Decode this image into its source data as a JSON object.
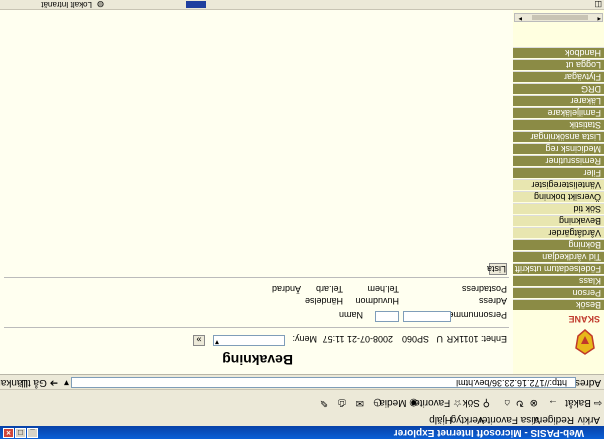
{
  "window": {
    "title": "Web-PASIS - Microsoft Internet Explorer"
  },
  "menu": {
    "items": [
      "Arkiv",
      "Redigera",
      "Visa",
      "Favoriter",
      "Verktyg",
      "Hjälp"
    ]
  },
  "toolbar": {
    "back": "Bakåt",
    "search": "Sök",
    "favorites": "Favoriter",
    "media": "Media"
  },
  "address": {
    "label": "Adress",
    "url": "http://172.16.23.36/bev.html",
    "go": "Gå till",
    "links": "Länkar"
  },
  "page": {
    "heading": "Bevakning",
    "logo_text": "SKANE",
    "user_id": "Enhet: 1011KR",
    "code_u": "U",
    "code_num": "SP060",
    "datetime": "2008-07-21 11:57",
    "menu_label": "Meny:",
    "go_btn": "»",
    "field_personnummer": "Personnummer",
    "field_namn": "Namn",
    "field_adress": "Adress",
    "field_postadress": "Postadress",
    "field_huvudmon": "Huvudmon",
    "field_tel_hem": "Tel.hem",
    "field_tel_arb": "Tel.arb",
    "field_handelse": "Händelse",
    "field_andrad": "Ändrad",
    "list_button": "Lista"
  },
  "sidebar": {
    "items": [
      {
        "label": "Besök",
        "sub": false
      },
      {
        "label": "Person",
        "sub": false
      },
      {
        "label": "Klass",
        "sub": false
      },
      {
        "label": "Födelsedatum utskrift",
        "sub": false
      },
      {
        "label": "Tid vårdkedjan",
        "sub": false
      },
      {
        "label": "Bokning",
        "sub": false
      },
      {
        "label": "Vårdåtgärder",
        "sub": true
      },
      {
        "label": "Bevakning",
        "sub": true
      },
      {
        "label": "Sök tid",
        "sub": true
      },
      {
        "label": "Översikt bokning",
        "sub": true
      },
      {
        "label": "Väntelisteregister",
        "sub": true
      },
      {
        "label": "Filer",
        "sub": false
      },
      {
        "label": "Remissrutiner",
        "sub": false
      },
      {
        "label": "Medicinsk reg",
        "sub": false
      },
      {
        "label": "Lista ansökningar",
        "sub": false
      },
      {
        "label": "Statistik",
        "sub": false
      },
      {
        "label": "Familjeläkare",
        "sub": false
      },
      {
        "label": "Läkarer",
        "sub": false
      },
      {
        "label": "DRG",
        "sub": false
      },
      {
        "label": "Flytvägar",
        "sub": false
      },
      {
        "label": "Logga ut",
        "sub": false
      },
      {
        "label": "Handbok",
        "sub": false
      }
    ]
  },
  "status": {
    "text": "Lokalt Intranät"
  },
  "colors": {
    "nav": "#8b8b45",
    "nav_sub": "#e8e6b0",
    "page_bg": "#fffff0",
    "sidebar_bg": "#ffffe0"
  }
}
